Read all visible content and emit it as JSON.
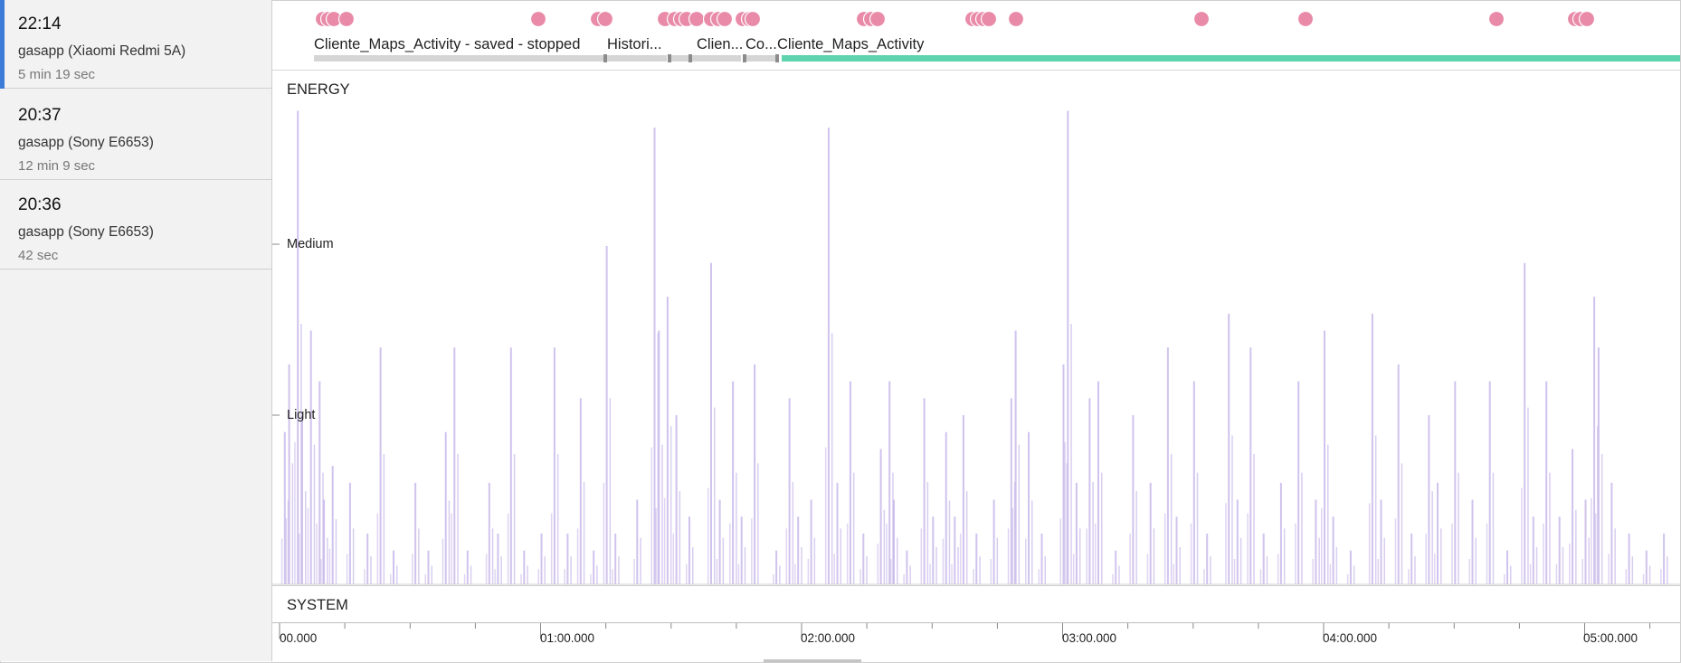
{
  "sessions": [
    {
      "time": "22:14",
      "app": "gasapp (Xiaomi Redmi 5A)",
      "duration": "5 min 19 sec",
      "selected": true
    },
    {
      "time": "20:37",
      "app": "gasapp (Sony E6653)",
      "duration": "12 min 9 sec",
      "selected": false
    },
    {
      "time": "20:36",
      "app": "gasapp (Sony E6653)",
      "duration": "42 sec",
      "selected": false
    }
  ],
  "timeline": {
    "activities": [
      "Cliente_Maps_Activity - saved - stopped",
      "Histori...",
      "Clien...",
      "Co...",
      "Cliente_Maps_Activity"
    ],
    "energy_label": "ENERGY",
    "system_label": "SYSTEM",
    "levels": [
      "Medium",
      "Light"
    ],
    "time_ticks": [
      "00.000",
      "01:00.000",
      "02:00.000",
      "03:00.000",
      "04:00.000",
      "05:00.000"
    ]
  },
  "colors": {
    "accent": "#3d7bd9",
    "event": "#e88aa8",
    "active": "#5fd3ad",
    "energy": "#c8b9ea",
    "sidebar": "#f2f2f2"
  },
  "chart_data": {
    "type": "bar",
    "title": "ENERGY",
    "xlabel": "",
    "ylabel": "",
    "y_levels": [
      "Light",
      "Medium"
    ],
    "xlim": [
      "00:00.000",
      "05:19.000"
    ],
    "series": [
      {
        "values": [
          [
            1,
            0.9
          ],
          [
            2,
            1.3
          ],
          [
            4,
            2.8
          ],
          [
            5,
            1.0
          ],
          [
            7,
            1.5
          ],
          [
            9,
            1.2
          ],
          [
            10,
            0.5
          ],
          [
            12,
            0.7
          ],
          [
            16,
            0.6
          ],
          [
            20,
            0.3
          ],
          [
            23,
            1.4
          ],
          [
            26,
            0.2
          ],
          [
            31,
            0.6
          ],
          [
            34,
            0.2
          ],
          [
            38,
            0.9
          ],
          [
            40,
            1.4
          ],
          [
            43,
            0.2
          ],
          [
            48,
            0.6
          ],
          [
            50,
            0.3
          ],
          [
            53,
            1.4
          ],
          [
            56,
            0.2
          ],
          [
            60,
            0.3
          ],
          [
            63,
            1.4
          ],
          [
            66,
            0.3
          ],
          [
            69,
            1.1
          ],
          [
            72,
            0.2
          ],
          [
            75,
            2.0
          ],
          [
            77,
            0.3
          ],
          [
            82,
            0.5
          ],
          [
            86,
            2.7
          ],
          [
            87,
            1.5
          ],
          [
            89,
            1.7
          ],
          [
            91,
            1.0
          ],
          [
            94,
            0.4
          ],
          [
            99,
            1.9
          ],
          [
            101,
            0.5
          ],
          [
            104,
            1.2
          ],
          [
            106,
            0.4
          ],
          [
            109,
            1.3
          ],
          [
            114,
            0.2
          ],
          [
            117,
            1.1
          ],
          [
            119,
            0.4
          ],
          [
            122,
            0.5
          ],
          [
            126,
            2.7
          ],
          [
            128,
            0.6
          ],
          [
            131,
            1.2
          ],
          [
            134,
            0.3
          ],
          [
            138,
            0.8
          ],
          [
            140,
            1.2
          ],
          [
            141,
            0.5
          ],
          [
            144,
            0.2
          ],
          [
            148,
            1.1
          ],
          [
            150,
            0.4
          ],
          [
            153,
            0.9
          ],
          [
            155,
            0.4
          ],
          [
            157,
            1.0
          ],
          [
            160,
            0.3
          ],
          [
            164,
            0.5
          ],
          [
            168,
            1.1
          ],
          [
            169,
            1.5
          ],
          [
            172,
            0.9
          ],
          [
            175,
            0.3
          ],
          [
            180,
            1.3
          ],
          [
            181,
            2.8
          ],
          [
            183,
            0.6
          ],
          [
            186,
            1.1
          ],
          [
            188,
            1.2
          ],
          [
            192,
            0.2
          ],
          [
            196,
            1.0
          ],
          [
            200,
            0.6
          ],
          [
            204,
            1.4
          ],
          [
            206,
            0.4
          ],
          [
            210,
            1.2
          ],
          [
            213,
            0.3
          ],
          [
            218,
            1.6
          ],
          [
            220,
            0.5
          ],
          [
            223,
            1.4
          ],
          [
            226,
            0.3
          ],
          [
            230,
            0.6
          ],
          [
            234,
            1.2
          ],
          [
            238,
            0.5
          ],
          [
            240,
            1.5
          ],
          [
            242,
            0.4
          ],
          [
            246,
            0.2
          ],
          [
            251,
            1.6
          ],
          [
            253,
            0.5
          ],
          [
            257,
            1.3
          ],
          [
            260,
            0.3
          ],
          [
            264,
            1.0
          ],
          [
            266,
            0.6
          ],
          [
            270,
            1.2
          ],
          [
            274,
            0.5
          ],
          [
            278,
            1.2
          ],
          [
            282,
            0.2
          ],
          [
            286,
            1.9
          ],
          [
            288,
            0.4
          ],
          [
            291,
            1.2
          ],
          [
            294,
            0.4
          ],
          [
            297,
            0.8
          ],
          [
            300,
            0.5
          ],
          [
            302,
            1.7
          ],
          [
            303,
            1.4
          ],
          [
            306,
            0.6
          ],
          [
            310,
            0.3
          ],
          [
            314,
            0.2
          ],
          [
            318,
            0.3
          ]
        ]
      }
    ]
  }
}
